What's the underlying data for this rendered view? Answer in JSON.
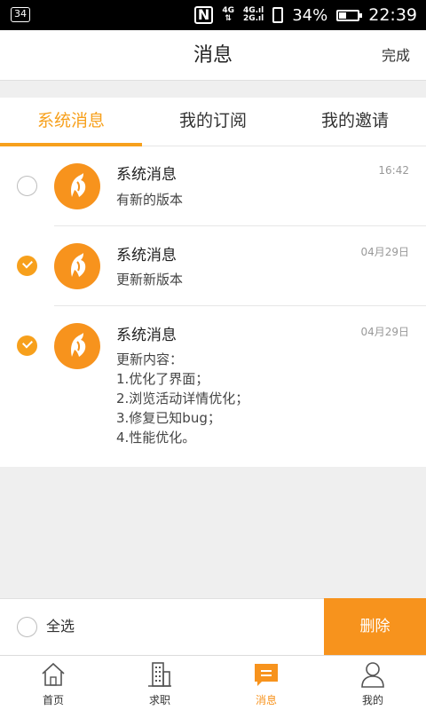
{
  "status_bar": {
    "notification_count": "34",
    "nfc": "N",
    "net1_top": "4G",
    "net2_top": "4G",
    "net2_bottom": "2G",
    "battery": "34%",
    "battery_level": 0.34,
    "time": "22:39"
  },
  "header": {
    "title": "消息",
    "done_label": "完成"
  },
  "tabs": [
    {
      "label": "系统消息",
      "active": true
    },
    {
      "label": "我的订阅",
      "active": false
    },
    {
      "label": "我的邀请",
      "active": false
    }
  ],
  "messages": [
    {
      "title": "系统消息",
      "time": "16:42",
      "checked": false,
      "lines": [
        "有新的版本"
      ]
    },
    {
      "title": "系统消息",
      "time": "04月29日",
      "checked": true,
      "lines": [
        "更新新版本"
      ]
    },
    {
      "title": "系统消息",
      "time": "04月29日",
      "checked": true,
      "lines": [
        "更新内容：",
        "1.优化了界面；",
        "2.浏览活动详情优化；",
        "3.修复已知bug；",
        "4.性能优化。"
      ]
    }
  ],
  "bottom_bar": {
    "select_all_label": "全选",
    "delete_label": "删除"
  },
  "tabbar": [
    {
      "label": "首页",
      "icon": "home-icon",
      "active": false
    },
    {
      "label": "求职",
      "icon": "building-icon",
      "active": false
    },
    {
      "label": "消息",
      "icon": "message-icon",
      "active": true
    },
    {
      "label": "我的",
      "icon": "person-icon",
      "active": false
    }
  ],
  "colors": {
    "accent": "#f7931d",
    "tab_active": "#f7a01c"
  }
}
